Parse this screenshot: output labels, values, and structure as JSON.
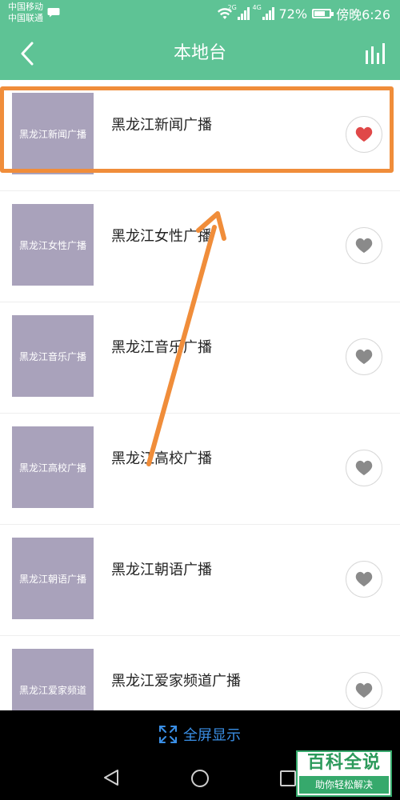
{
  "status_bar": {
    "carrier_1": "中国移动",
    "carrier_2": "中国联通",
    "network_tag_1": "2G",
    "network_tag_2": "4G",
    "battery_percent": "72%",
    "battery_level": 0.72,
    "time": "傍晚6:26"
  },
  "app_bar": {
    "title": "本地台",
    "back_icon": "chevron-left-icon",
    "equalizer_icon": "equalizer-icon"
  },
  "stations": [
    {
      "thumb_label": "黑龙江新闻广播",
      "title": "黑龙江新闻广播",
      "favorited": true
    },
    {
      "thumb_label": "黑龙江女性广播",
      "title": "黑龙江女性广播",
      "favorited": false
    },
    {
      "thumb_label": "黑龙江音乐广播",
      "title": "黑龙江音乐广播",
      "favorited": false
    },
    {
      "thumb_label": "黑龙江高校广播",
      "title": "黑龙江高校广播",
      "favorited": false
    },
    {
      "thumb_label": "黑龙江朝语广播",
      "title": "黑龙江朝语广播",
      "favorited": false
    },
    {
      "thumb_label": "黑龙江爱家频道",
      "title": "黑龙江爱家频道广播",
      "favorited": false
    }
  ],
  "bottom_bar": {
    "fullscreen_label": "全屏显示",
    "fullscreen_icon": "expand-icon"
  },
  "watermark": {
    "main": "百科全说",
    "sub": "助你轻松解决"
  },
  "colors": {
    "header": "#5ec395",
    "favorite_active": "#e04848",
    "favorite_inactive": "#8a8a8a",
    "annotation": "#f08d3a",
    "fullscreen_text": "#3a8fe6"
  }
}
